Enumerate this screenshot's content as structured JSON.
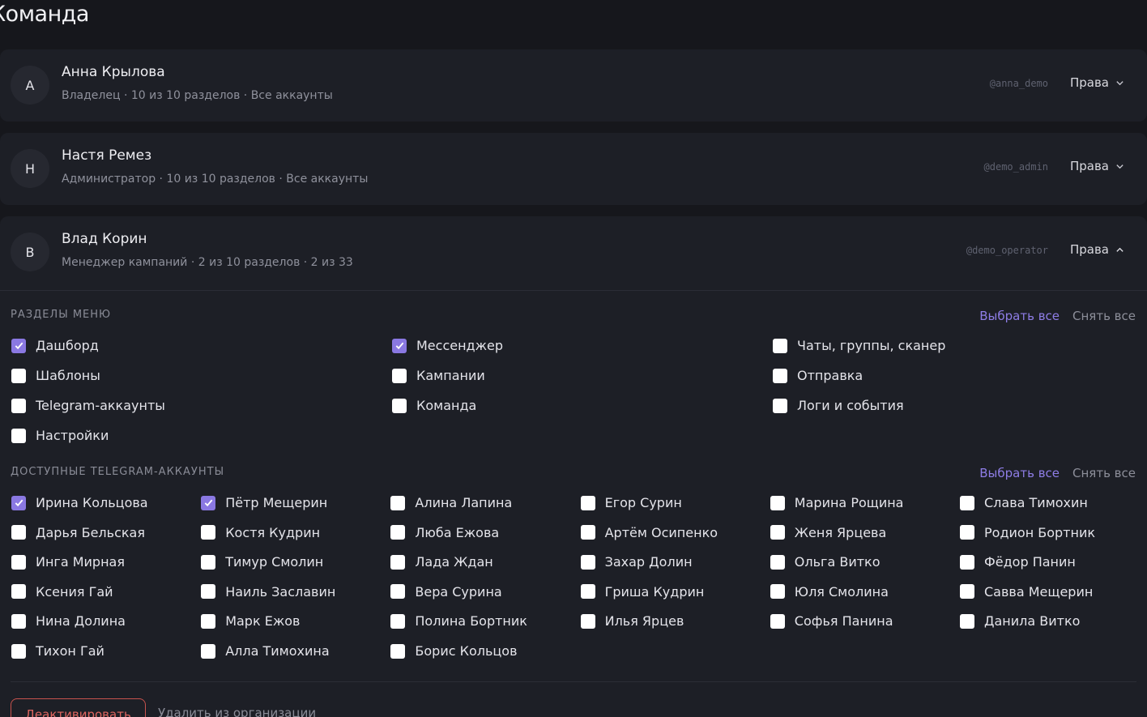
{
  "page": {
    "title": "Команда"
  },
  "members": [
    {
      "initial": "А",
      "name": "Анна Крылова",
      "meta": "Владелец · 10 из 10 разделов · Все аккаунты",
      "handle": "@anna_demo",
      "rights_label": "Права",
      "expanded": false
    },
    {
      "initial": "Н",
      "name": "Настя Ремез",
      "meta": "Администратор · 10 из 10 разделов · Все аккаунты",
      "handle": "@demo_admin",
      "rights_label": "Права",
      "expanded": false
    },
    {
      "initial": "В",
      "name": "Влад Корин",
      "meta": "Менеджер кампаний · 2 из 10 разделов · 2 из 33",
      "handle": "@demo_operator",
      "rights_label": "Права",
      "expanded": true
    }
  ],
  "menu_sections": {
    "heading": "РАЗДЕЛЫ МЕНЮ",
    "select_all": "Выбрать все",
    "clear_all": "Снять все",
    "items": [
      {
        "label": "Дашборд",
        "checked": true
      },
      {
        "label": "Мессенджер",
        "checked": true
      },
      {
        "label": "Чаты, группы, сканер",
        "checked": false
      },
      {
        "label": "Шаблоны",
        "checked": false
      },
      {
        "label": "Кампании",
        "checked": false
      },
      {
        "label": "Отправка",
        "checked": false
      },
      {
        "label": "Telegram-аккаунты",
        "checked": false
      },
      {
        "label": "Команда",
        "checked": false
      },
      {
        "label": "Логи и события",
        "checked": false
      },
      {
        "label": "Настройки",
        "checked": false
      }
    ]
  },
  "telegram_accounts": {
    "heading": "ДОСТУПНЫЕ TELEGRAM-АККАУНТЫ",
    "select_all": "Выбрать все",
    "clear_all": "Снять все",
    "items": [
      {
        "label": "Ирина Кольцова",
        "checked": true
      },
      {
        "label": "Пётр Мещерин",
        "checked": true
      },
      {
        "label": "Алина Лапина",
        "checked": false
      },
      {
        "label": "Егор Сурин",
        "checked": false
      },
      {
        "label": "Марина Рощина",
        "checked": false
      },
      {
        "label": "Слава Тимохин",
        "checked": false
      },
      {
        "label": "Дарья Бельская",
        "checked": false
      },
      {
        "label": "Костя Кудрин",
        "checked": false
      },
      {
        "label": "Люба Ежова",
        "checked": false
      },
      {
        "label": "Артём Осипенко",
        "checked": false
      },
      {
        "label": "Женя Ярцева",
        "checked": false
      },
      {
        "label": "Родион Бортник",
        "checked": false
      },
      {
        "label": "Инга Мирная",
        "checked": false
      },
      {
        "label": "Тимур Смолин",
        "checked": false
      },
      {
        "label": "Лада Ждан",
        "checked": false
      },
      {
        "label": "Захар Долин",
        "checked": false
      },
      {
        "label": "Ольга Витко",
        "checked": false
      },
      {
        "label": "Фёдор Панин",
        "checked": false
      },
      {
        "label": "Ксения Гай",
        "checked": false
      },
      {
        "label": "Наиль Заславин",
        "checked": false
      },
      {
        "label": "Вера Сурина",
        "checked": false
      },
      {
        "label": "Гриша Кудрин",
        "checked": false
      },
      {
        "label": "Юля Смолина",
        "checked": false
      },
      {
        "label": "Савва Мещерин",
        "checked": false
      },
      {
        "label": "Нина Долина",
        "checked": false
      },
      {
        "label": "Марк Ежов",
        "checked": false
      },
      {
        "label": "Полина Бортник",
        "checked": false
      },
      {
        "label": "Илья Ярцев",
        "checked": false
      },
      {
        "label": "Софья Панина",
        "checked": false
      },
      {
        "label": "Данила Витко",
        "checked": false
      },
      {
        "label": "Тихон Гай",
        "checked": false
      },
      {
        "label": "Алла Тимохина",
        "checked": false
      },
      {
        "label": "Борис Кольцов",
        "checked": false
      }
    ]
  },
  "actions": {
    "deactivate": "Деактивировать",
    "remove": "Удалить из организации"
  },
  "colors": {
    "accent": "#8a78e2",
    "danger": "#e06660",
    "background": "#16171c",
    "card": "#1d1f26"
  }
}
